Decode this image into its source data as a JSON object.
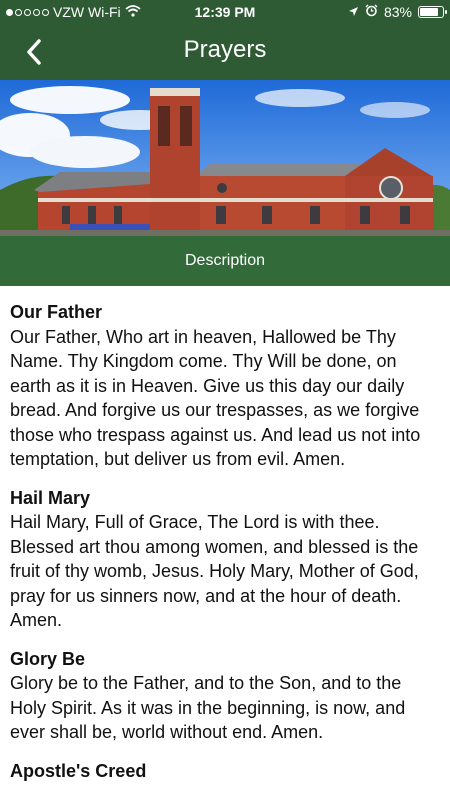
{
  "status_bar": {
    "carrier": "VZW Wi-Fi",
    "time": "12:39 PM",
    "battery": "83%",
    "battery_level": 0.83,
    "signal_bars": 1,
    "icons": [
      "wifi-icon",
      "location-icon",
      "alarm-icon",
      "battery-icon"
    ]
  },
  "nav": {
    "title": "Prayers",
    "back_icon": "chevron-left-icon"
  },
  "hero": {
    "image": "church-building-photo"
  },
  "description_label": "Description",
  "prayers": [
    {
      "title": "Our Father",
      "text": "Our Father, Who art in heaven, Hallowed be Thy Name. Thy Kingdom come. Thy Will be done, on earth as it is in Heaven. Give us this day our daily bread. And forgive us our trespasses, as we forgive those who trespass against us. And lead us not into temptation, but deliver us from evil. Amen."
    },
    {
      "title": "Hail Mary",
      "text": "Hail Mary, Full of Grace, The Lord is with thee. Blessed art thou among women, and blessed is the fruit of thy womb, Jesus. Holy Mary, Mother of God, pray for us sinners now, and at the hour of death. Amen."
    },
    {
      "title": "Glory Be",
      "text": "Glory be to the Father, and to the Son, and to the Holy Spirit. As it was in the beginning, is now, and ever shall be, world without end. Amen."
    },
    {
      "title": "Apostle's Creed",
      "text": ""
    }
  ],
  "colors": {
    "header": "#2e5a34",
    "description_bar": "#336a3a"
  }
}
